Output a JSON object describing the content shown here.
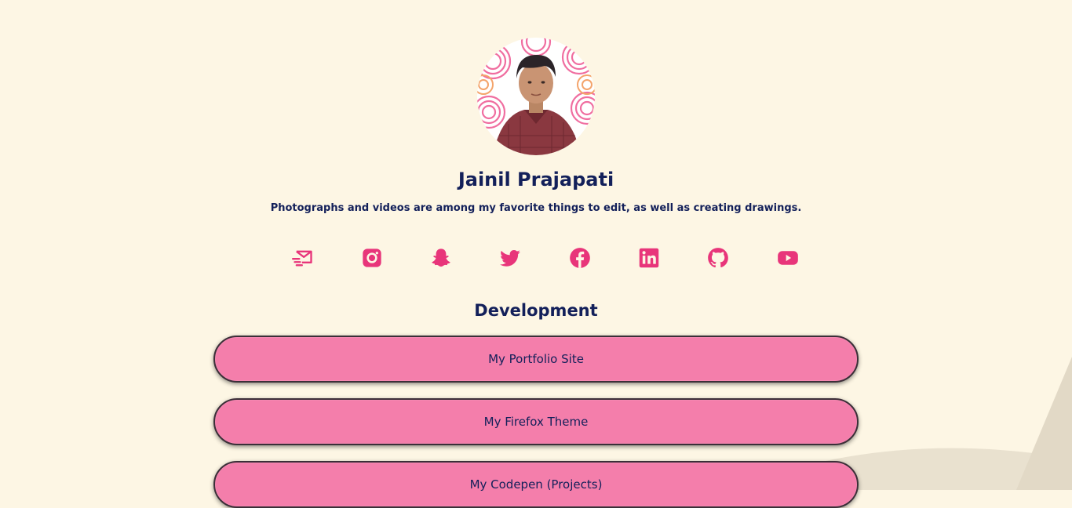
{
  "profile": {
    "name": "Jainil Prajapati",
    "bio": "Photographs and videos are among my favorite things to edit, as well as creating drawings."
  },
  "socials": [
    {
      "icon": "mail-icon",
      "name": "social-email"
    },
    {
      "icon": "instagram-icon",
      "name": "social-instagram"
    },
    {
      "icon": "snapchat-icon",
      "name": "social-snapchat"
    },
    {
      "icon": "twitter-icon",
      "name": "social-twitter"
    },
    {
      "icon": "facebook-icon",
      "name": "social-facebook"
    },
    {
      "icon": "linkedin-icon",
      "name": "social-linkedin"
    },
    {
      "icon": "github-icon",
      "name": "social-github"
    },
    {
      "icon": "youtube-icon",
      "name": "social-youtube"
    }
  ],
  "section": {
    "title": "Development"
  },
  "links": [
    {
      "label": "My Portfolio Site"
    },
    {
      "label": "My Firefox Theme"
    },
    {
      "label": "My Codepen (Projects)"
    }
  ],
  "colors": {
    "background": "#fdf6e4",
    "accent": "#e8357a",
    "button": "#f47eab",
    "text": "#13205a"
  }
}
